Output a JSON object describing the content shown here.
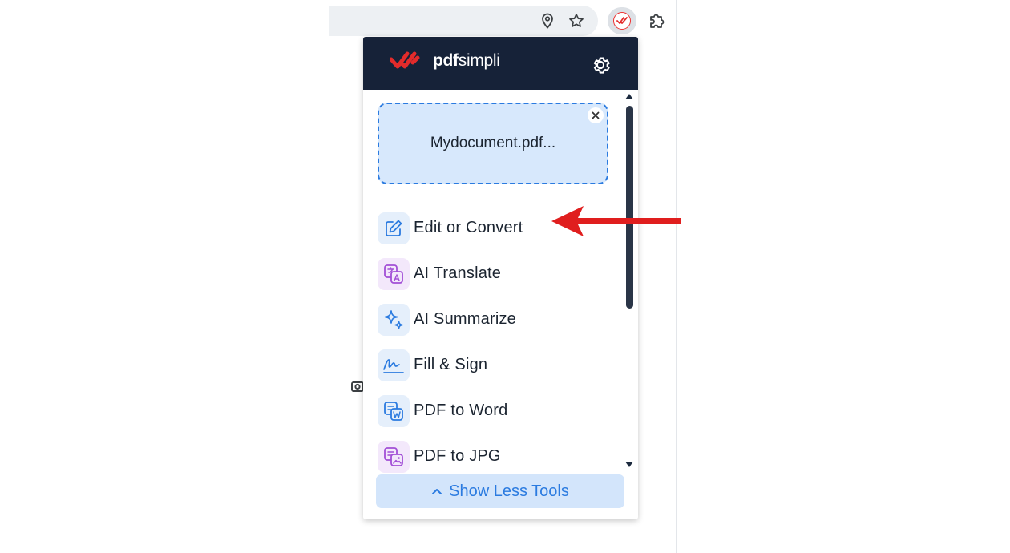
{
  "colors": {
    "header_bg": "#162238",
    "accent_blue": "#2b7be0",
    "file_card_bg": "#d7e8fc",
    "brand_red": "#e32b2b",
    "annotation_arrow": "#e01e1e"
  },
  "browser": {
    "omnibox_icons": [
      "location-pin-icon",
      "star-icon"
    ],
    "extension_icon": "pdfsimpli-extension-icon",
    "extensions_menu_icon": "puzzle-icon"
  },
  "popup": {
    "brand": {
      "logo_icon": "double-check-logo-icon",
      "bold": "pdf",
      "regular": "simpli"
    },
    "settings_icon": "gear-icon",
    "file": {
      "name": "Mydocument.pdf...",
      "close_icon": "close-icon"
    },
    "tools": [
      {
        "label": "Edit or Convert",
        "icon": "edit-pencil-icon"
      },
      {
        "label": "AI Translate",
        "icon": "translate-icon"
      },
      {
        "label": "AI Summarize",
        "icon": "sparkle-icon"
      },
      {
        "label": "Fill & Sign",
        "icon": "signature-icon"
      },
      {
        "label": "PDF to Word",
        "icon": "word-doc-icon"
      },
      {
        "label": "PDF to JPG",
        "icon": "image-doc-icon"
      }
    ],
    "show_less": {
      "label": "Show Less Tools",
      "icon": "chevron-up-icon"
    }
  },
  "annotation": {
    "icon": "red-arrow-icon",
    "points_to": "Edit or Convert"
  }
}
